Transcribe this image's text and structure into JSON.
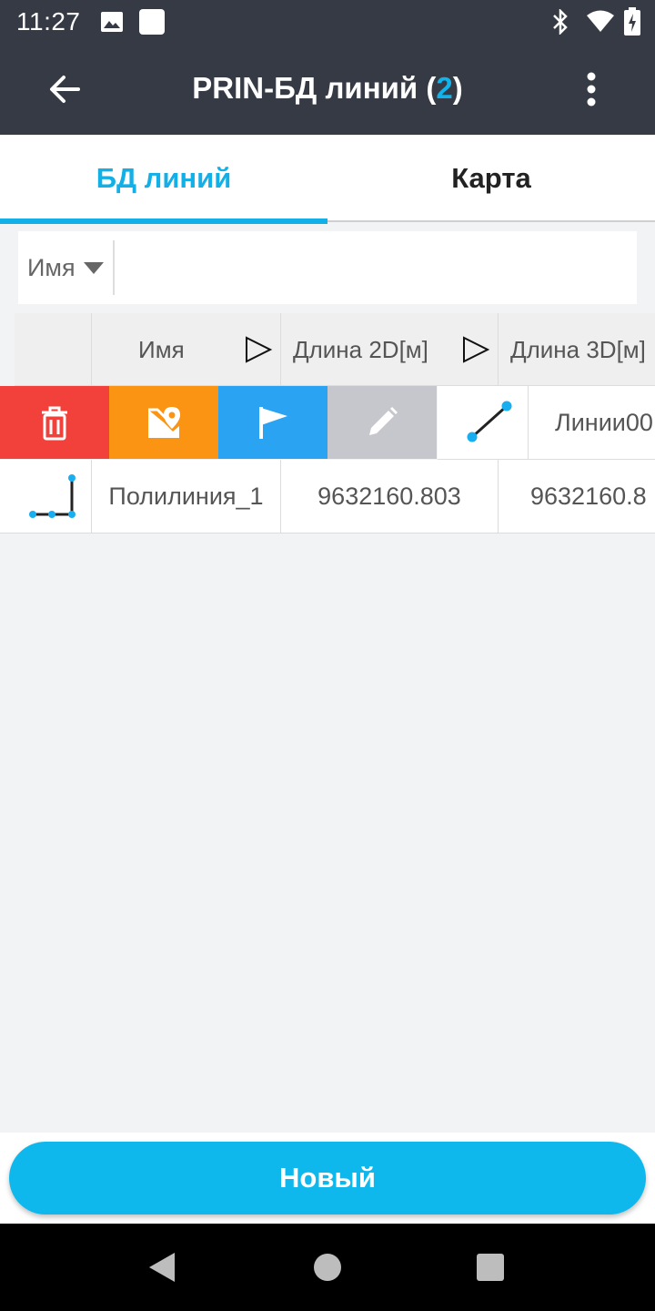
{
  "status_bar": {
    "time": "11:27",
    "icons": [
      "image-icon",
      "square-notification-icon",
      "bluetooth-icon",
      "wifi-icon",
      "battery-charging-icon"
    ]
  },
  "app_bar": {
    "title": "PRIN-БД линий (",
    "count": "2",
    "title_suffix": ")",
    "back_icon": "arrow-left-icon",
    "menu_icon": "more-vertical-icon"
  },
  "tabs": [
    {
      "label": "БД линий",
      "active": true
    },
    {
      "label": "Карта",
      "active": false
    }
  ],
  "search": {
    "field_label": "Имя",
    "value": "",
    "placeholder": ""
  },
  "table": {
    "columns": [
      "",
      "Имя",
      "Длина 2D[м]",
      "Длина 3D[м]"
    ],
    "swipe_actions": [
      {
        "icon": "trash-icon",
        "color": "#f2403a"
      },
      {
        "icon": "map-pin-icon",
        "color": "#fb9413"
      },
      {
        "icon": "flag-icon",
        "color": "#2aa3f2"
      },
      {
        "icon": "pencil-icon",
        "color": "#c6c7cc"
      }
    ],
    "rows": [
      {
        "icon": "line-icon",
        "name": "Линии00",
        "len2d": "",
        "len3d": ""
      },
      {
        "icon": "polyline-icon",
        "name": "Полилиния_1",
        "len2d": "9632160.803",
        "len3d": "9632160.8"
      }
    ]
  },
  "actions": {
    "new_button": "Новый"
  },
  "colors": {
    "accent": "#12b0e6",
    "appbar": "#353a44",
    "delete": "#f2403a",
    "locate": "#fb9413",
    "flag": "#2aa3f2"
  }
}
